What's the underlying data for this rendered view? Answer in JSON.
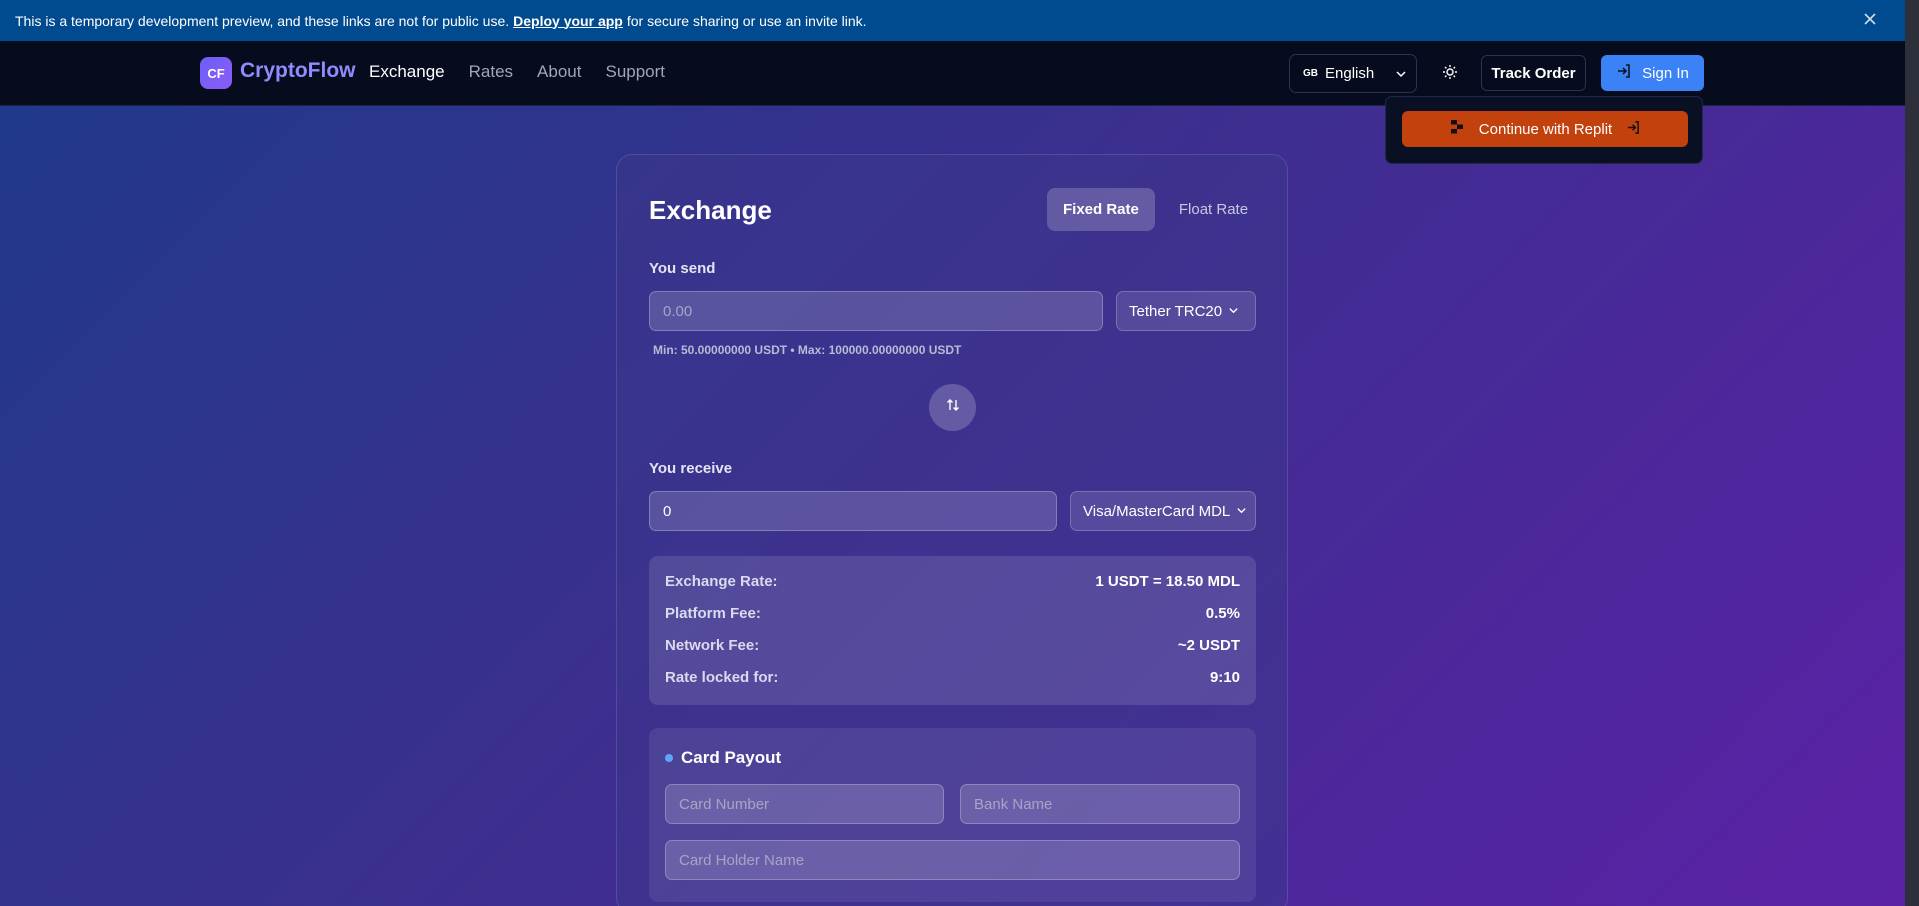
{
  "banner": {
    "text_before": "This is a temporary development preview, and these links are not for public use.",
    "link_label": "Deploy your app",
    "text_after": "for secure sharing or use an invite link."
  },
  "header": {
    "logo_badge": "CF",
    "logo_text": "CryptoFlow",
    "nav": [
      "Exchange",
      "Rates",
      "About",
      "Support"
    ],
    "active_nav": "Exchange",
    "language_flag": "GB",
    "language": "English",
    "track_order": "Track Order",
    "sign_in": "Sign In"
  },
  "popup": {
    "replit_label": "Continue with Replit"
  },
  "exchange": {
    "title": "Exchange",
    "rate_options": [
      "Fixed Rate",
      "Float Rate"
    ],
    "active_rate": "Fixed Rate",
    "send": {
      "label": "You send",
      "placeholder": "0.00",
      "currency": "Tether TRC20",
      "limits": "Min: 50.00000000 USDT • Max: 100000.00000000 USDT"
    },
    "receive": {
      "label": "You receive",
      "value": "0",
      "currency": "Visa/MasterCard MDL"
    },
    "info": [
      {
        "key": "Exchange Rate:",
        "value": "1 USDT = 18.50 MDL"
      },
      {
        "key": "Platform Fee:",
        "value": "0.5%"
      },
      {
        "key": "Network Fee:",
        "value": "~2 USDT"
      },
      {
        "key": "Rate locked for:",
        "value": "9:10"
      }
    ],
    "payout": {
      "title": "Card Payout",
      "card_number_placeholder": "Card Number",
      "bank_name_placeholder": "Bank Name",
      "holder_placeholder": "Card Holder Name"
    }
  },
  "colors": {
    "banner": "#004a8f",
    "header": "#060b1d",
    "accent_blue": "#3b82f6",
    "replit_orange": "#c2410c",
    "logo_purple": "#8f8cff"
  },
  "icons": [
    "close-icon",
    "chevron-down-icon",
    "sun-icon",
    "login-icon",
    "replit-icon",
    "swap-icon"
  ]
}
